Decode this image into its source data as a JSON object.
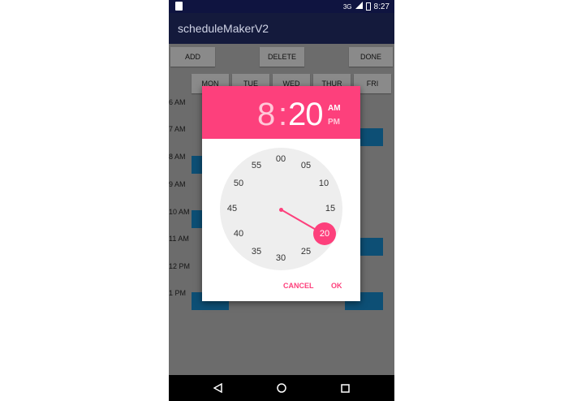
{
  "status": {
    "signal": "3G",
    "time": "8:27"
  },
  "app": {
    "title": "scheduleMakerV2"
  },
  "actions": {
    "add": "ADD",
    "delete": "DELETE",
    "done": "DONE"
  },
  "days": [
    "MON",
    "TUE",
    "WED",
    "THUR",
    "FRI"
  ],
  "times": [
    "6 AM",
    "7 AM",
    "8 AM",
    "9 AM",
    "10 AM",
    "11 AM",
    "12 PM",
    "1 PM"
  ],
  "picker": {
    "hour": "8",
    "colon": ":",
    "minute": "20",
    "am": "AM",
    "pm": "PM",
    "minute_labels": [
      "00",
      "05",
      "10",
      "15",
      "20",
      "25",
      "30",
      "35",
      "40",
      "45",
      "50",
      "55"
    ],
    "selected_minute": "20",
    "cancel": "CANCEL",
    "ok": "OK"
  },
  "colors": {
    "accent": "#fd407c",
    "appbar": "#141a3c",
    "slot": "#0d4f75"
  },
  "icons": {
    "back": "triangle-back-icon",
    "home": "circle-home-icon",
    "recents": "square-recents-icon"
  }
}
